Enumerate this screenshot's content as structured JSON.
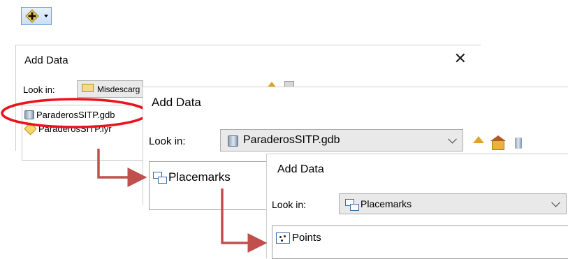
{
  "toolbar": {
    "add_data_button": "add-data-icon"
  },
  "dialog1": {
    "title": "Add Data",
    "close": "✕",
    "look_in_label": "Look in:",
    "look_in_value": "Misdescarg",
    "items": [
      {
        "label": "ParaderosSITP.gdb",
        "icon": "geodatabase-icon"
      },
      {
        "label": "ParaderosSITP.lyr",
        "icon": "layer-file-icon"
      }
    ]
  },
  "dialog2": {
    "title": "Add Data",
    "look_in_label": "Look in:",
    "look_in_value": "ParaderosSITP.gdb",
    "items": [
      {
        "label": "Placemarks",
        "icon": "feature-dataset-icon"
      }
    ]
  },
  "dialog3": {
    "title": "Add Data",
    "look_in_label": "Look in:",
    "look_in_value": "Placemarks",
    "items": [
      {
        "label": "Points",
        "icon": "point-feature-class-icon"
      }
    ]
  },
  "colors": {
    "highlight_ellipse": "#e8141b",
    "flow_arrow": "#c0504d",
    "toolbar_button": "#c9dff4"
  }
}
